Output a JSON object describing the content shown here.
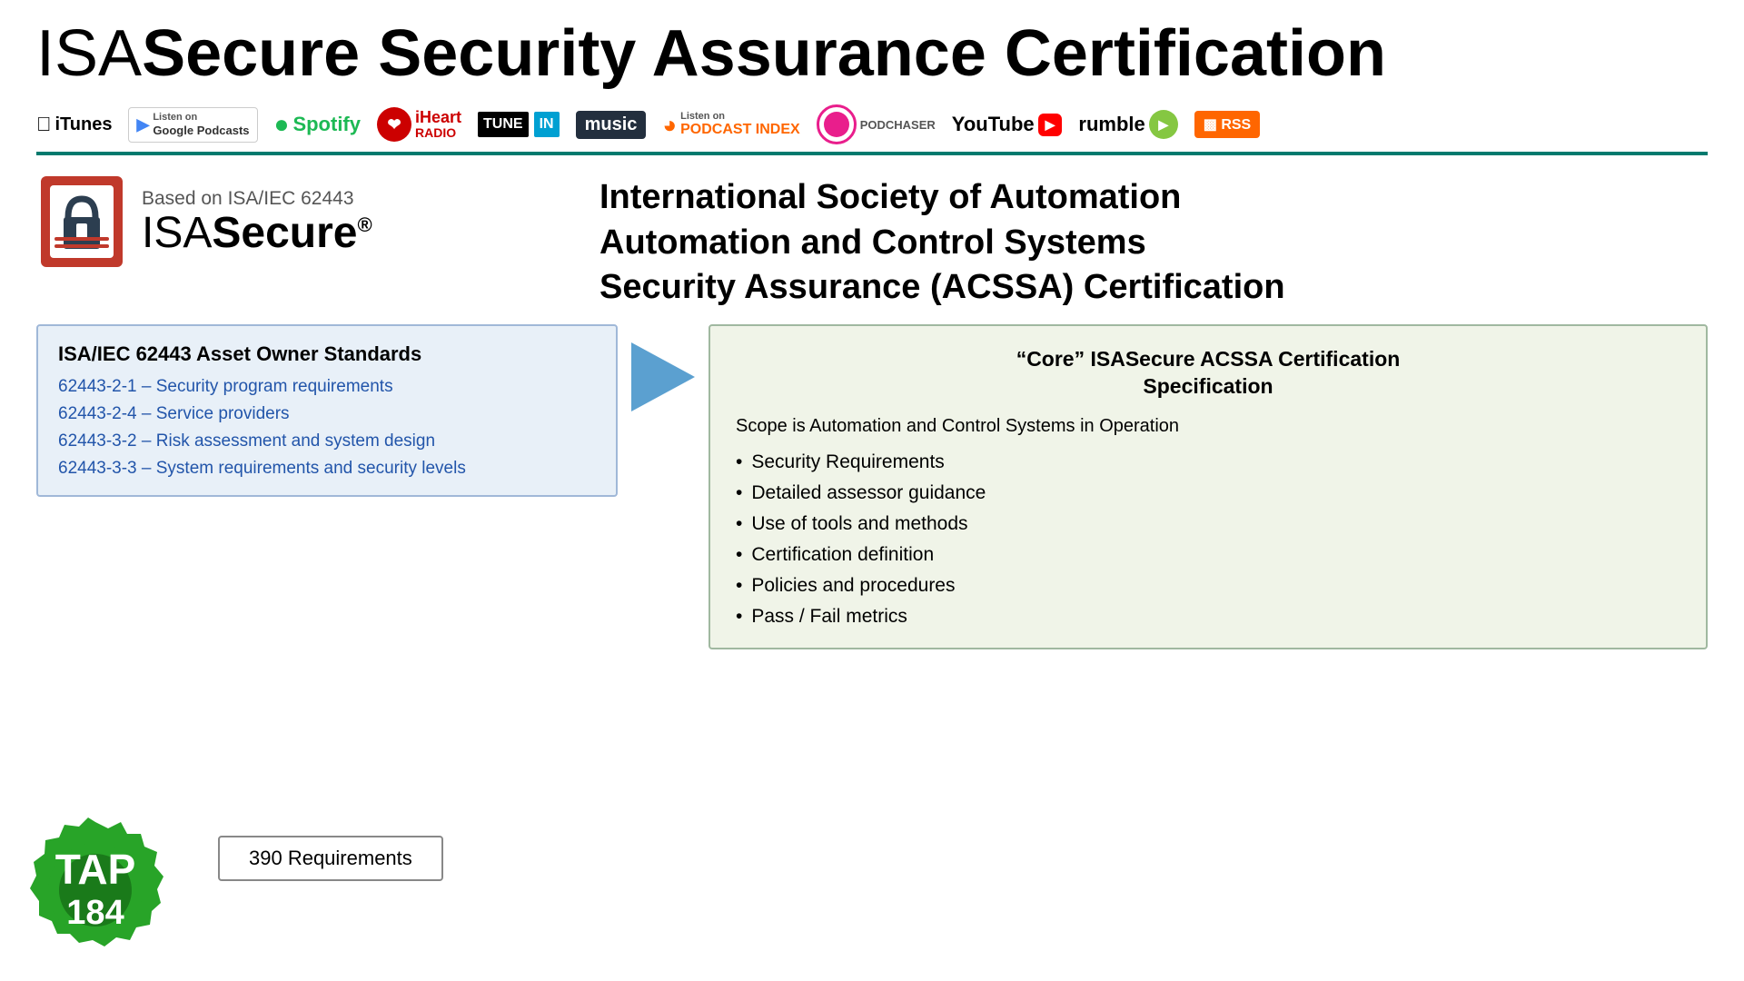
{
  "title": {
    "part1": "ISA",
    "part2": "Secure Security Assurance Certification"
  },
  "podcasts": [
    {
      "name": "iTunes",
      "label": "iTunes"
    },
    {
      "name": "Google Podcasts",
      "label": "Listen on\nGoogle Podcasts"
    },
    {
      "name": "Spotify",
      "label": "Spotify"
    },
    {
      "name": "iHeartRadio",
      "label": "iHeart\nRADIO"
    },
    {
      "name": "TuneIn",
      "label": "TUNE IN"
    },
    {
      "name": "Amazon Music",
      "label": "music"
    },
    {
      "name": "Podcast Index",
      "label": "Listen on\nPODCAST INDEX"
    },
    {
      "name": "Podchaser",
      "label": "PODCHASER"
    },
    {
      "name": "YouTube",
      "label": "YouTube"
    },
    {
      "name": "Rumble",
      "label": "rumble"
    },
    {
      "name": "RSS",
      "label": "RSS"
    }
  ],
  "logo": {
    "based_on": "Based on ISA/IEC 62443",
    "name_isa": "ISA",
    "name_secure": "Secure",
    "registered": "®"
  },
  "heading_right": {
    "line1": "International Society of Automation",
    "line2": "Automation and Control Systems",
    "line3": "Security Assurance (ACSSA) Certification"
  },
  "standards_box": {
    "title": "ISA/IEC 62443 Asset Owner Standards",
    "items": [
      "62443-2-1 – Security program requirements",
      "62443-2-4 – Service providers",
      "62443-3-2 – Risk assessment and system design",
      "62443-3-3 – System requirements and security levels"
    ]
  },
  "requirements": {
    "label": "390 Requirements"
  },
  "cert_box": {
    "title_line1": "“Core” ISASecure ACSSA Certification",
    "title_line2": "Specification",
    "scope": "Scope is Automation and Control Systems in Operation",
    "items": [
      "Security Requirements",
      "Detailed assessor guidance",
      "Use of tools and methods",
      "Certification definition",
      "Policies and procedures",
      "Pass / Fail metrics"
    ]
  },
  "tap_badge": {
    "line1": "TAP",
    "line2": "184"
  }
}
